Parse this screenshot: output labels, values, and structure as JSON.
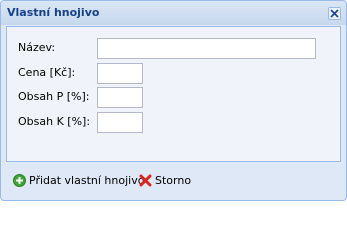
{
  "window": {
    "title": "Vlastní hnojivo"
  },
  "form": {
    "fields": [
      {
        "label": "Název:",
        "value": ""
      },
      {
        "label": "Cena [Kč]:",
        "value": ""
      },
      {
        "label": "Obsah P [%]:",
        "value": ""
      },
      {
        "label": "Obsah K [%]:",
        "value": ""
      }
    ]
  },
  "footer": {
    "add_label": "Přidat vlastní hnojivo",
    "cancel_label": "Storno"
  },
  "icons": {
    "close": "close-icon",
    "add": "plus-circle-icon",
    "cancel": "red-x-icon"
  },
  "colors": {
    "title_text": "#15428b",
    "window_border": "#99bbe8",
    "add_icon": "#3fa635",
    "cancel_icon": "#d9261c"
  }
}
